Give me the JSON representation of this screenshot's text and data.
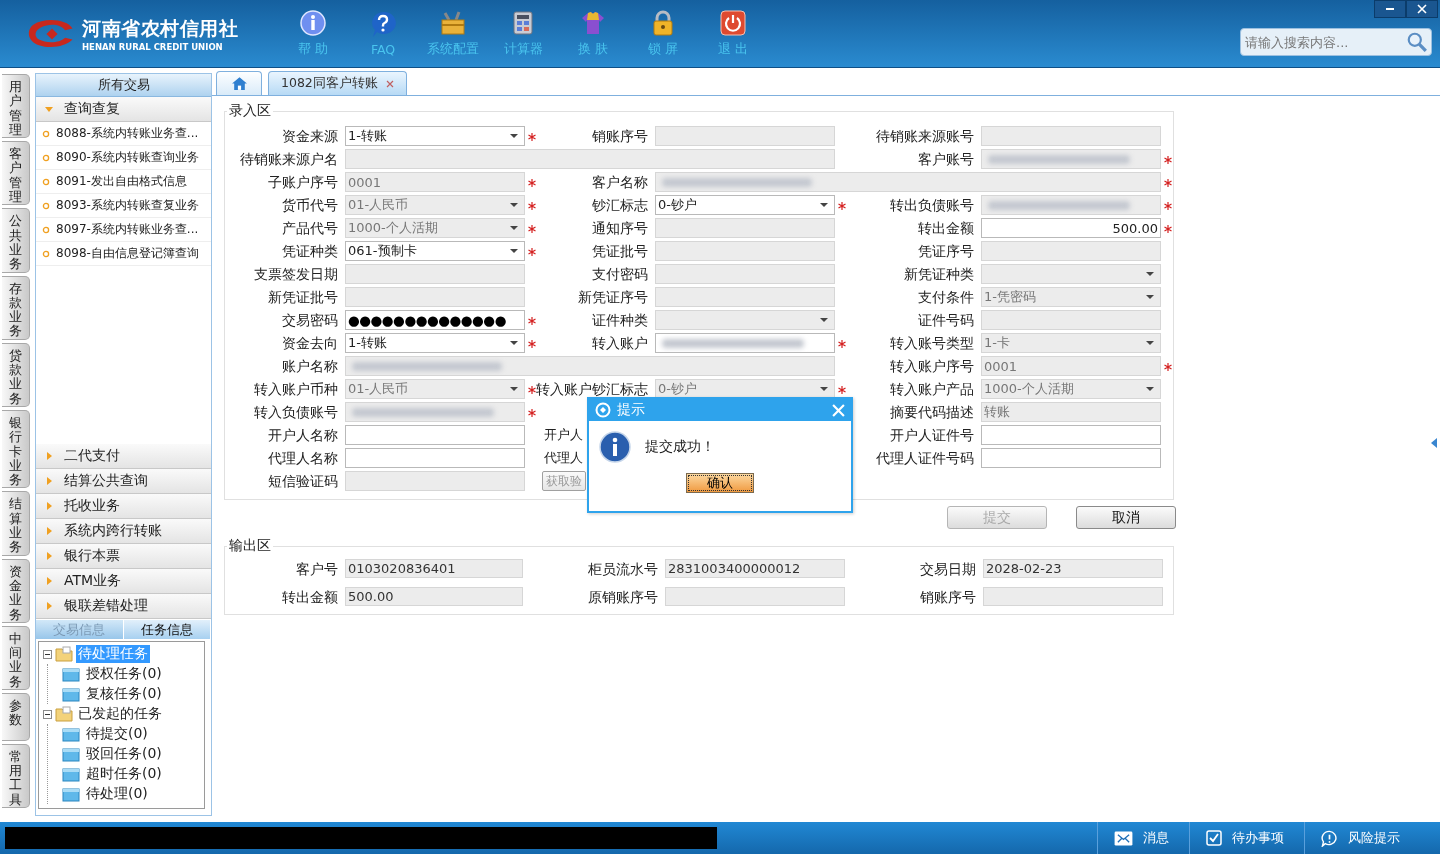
{
  "app": {
    "logo_title": "河南省农村信用社",
    "logo_subtitle": "HENAN RURAL CREDIT UNION"
  },
  "toolbar": [
    {
      "label": "帮 助",
      "kind": "help"
    },
    {
      "label": "FAQ",
      "kind": "faq"
    },
    {
      "label": "系统配置",
      "kind": "config"
    },
    {
      "label": "计算器",
      "kind": "calculator"
    },
    {
      "label": "换 肤",
      "kind": "skin"
    },
    {
      "label": "锁 屏",
      "kind": "lock"
    },
    {
      "label": "退 出",
      "kind": "exit"
    }
  ],
  "search": {
    "placeholder": "请输入搜索内容..."
  },
  "side_tabs": [
    "用户管理",
    "客户管理",
    "公共业务",
    "存款业务",
    "贷款业务",
    "银行卡业务",
    "结算业务",
    "资金业务",
    "中间业务",
    "参数",
    "常用工具"
  ],
  "sidebar": {
    "title": "所有交易",
    "groups": [
      {
        "label": "查询查复",
        "expanded": true,
        "items": [
          "8088-系统内转账业务查...",
          "8090-系统内转账查询业务",
          "8091-发出自由格式信息",
          "8093-系统内转账查复业务",
          "8097-系统内转账业务查...",
          "8098-自由信息登记簿查询"
        ]
      },
      {
        "label": "二代支付",
        "expanded": false
      },
      {
        "label": "结算公共查询",
        "expanded": false
      },
      {
        "label": "托收业务",
        "expanded": false
      },
      {
        "label": "系统内跨行转账",
        "expanded": false
      },
      {
        "label": "银行本票",
        "expanded": false
      },
      {
        "label": "ATM业务",
        "expanded": false
      },
      {
        "label": "银联差错处理",
        "expanded": false
      }
    ]
  },
  "task_panel": {
    "tabs": [
      {
        "label": "交易信息",
        "selected": false
      },
      {
        "label": "任务信息",
        "selected": true
      }
    ],
    "tree": [
      {
        "label": "待处理任务",
        "expanded": true,
        "selected": true,
        "children": [
          {
            "label": "授权任务(0)",
            "selected": false
          },
          {
            "label": "复核任务(0)",
            "selected": false
          }
        ]
      },
      {
        "label": "已发起的任务",
        "expanded": true,
        "selected": false,
        "children": [
          {
            "label": "待提交(0)",
            "selected": false
          },
          {
            "label": "驳回任务(0)",
            "selected": false
          },
          {
            "label": "超时任务(0)",
            "selected": false
          },
          {
            "label": "待处理(0)",
            "selected": false
          }
        ]
      }
    ]
  },
  "tabs": [
    {
      "kind": "home",
      "selected": false
    },
    {
      "kind": "page",
      "label": "1082同客户转账",
      "selected": true
    }
  ],
  "entry": {
    "title": "录入区",
    "rows": [
      {
        "col_1": {
          "label": "资金来源",
          "kind": "select",
          "value": "1-转账",
          "disabled": false,
          "required": true
        },
        "col_2": {
          "label": "销账序号",
          "kind": "input",
          "disabled": true,
          "required": false
        },
        "col_3": {
          "label": "待销账来源账号",
          "kind": "input",
          "disabled": true,
          "required": false
        }
      },
      {
        "col_1": {
          "label": "待销账来源户名",
          "kind": "wide",
          "disabled": true,
          "required": false
        },
        "col_3": {
          "label": "客户账号",
          "kind": "input",
          "disabled": true,
          "required": true,
          "redacted": true
        }
      },
      {
        "col_1": {
          "label": "子账户序号",
          "kind": "input",
          "value": "0001",
          "disabled": true,
          "required": true
        },
        "col_2": {
          "label": "客户名称",
          "kind": "wide",
          "disabled": true,
          "required": true,
          "redacted": true
        }
      },
      {
        "col_1": {
          "label": "货币代号",
          "kind": "select",
          "value": "01-人民币",
          "disabled": true,
          "required": true
        },
        "col_2": {
          "label": "钞汇标志",
          "kind": "select",
          "value": "0-钞户",
          "disabled": false,
          "required": true
        },
        "col_3": {
          "label": "转出负债账号",
          "kind": "input",
          "disabled": true,
          "required": true,
          "redacted": true
        }
      },
      {
        "col_1": {
          "label": "产品代号",
          "kind": "select",
          "value": "1000-个人活期",
          "disabled": true,
          "required": true
        },
        "col_2": {
          "label": "通知序号",
          "kind": "input",
          "disabled": true,
          "required": false
        },
        "col_3": {
          "label": "转出金额",
          "kind": "amount",
          "value": "500.00",
          "disabled": false,
          "required": true
        }
      },
      {
        "col_1": {
          "label": "凭证种类",
          "kind": "select",
          "value": "061-预制卡",
          "disabled": false,
          "required": true
        },
        "col_2": {
          "label": "凭证批号",
          "kind": "input",
          "disabled": true,
          "required": false
        },
        "col_3": {
          "label": "凭证序号",
          "kind": "input",
          "disabled": true,
          "required": false
        }
      },
      {
        "col_1": {
          "label": "支票签发日期",
          "kind": "input",
          "disabled": true,
          "required": false
        },
        "col_2": {
          "label": "支付密码",
          "kind": "input",
          "disabled": true,
          "required": false
        },
        "col_3": {
          "label": "新凭证种类",
          "kind": "select",
          "disabled": true,
          "required": false
        }
      },
      {
        "col_1": {
          "label": "新凭证批号",
          "kind": "input",
          "disabled": true,
          "required": false
        },
        "col_2": {
          "label": "新凭证序号",
          "kind": "input",
          "disabled": true,
          "required": false
        },
        "col_3": {
          "label": "支付条件",
          "kind": "select",
          "value": "1-凭密码",
          "disabled": true,
          "required": false
        }
      },
      {
        "col_1": {
          "label": "交易密码",
          "kind": "password",
          "value": "●●●●●●●●●●●●●●",
          "disabled": false,
          "required": true
        },
        "col_2": {
          "label": "证件种类",
          "kind": "select",
          "disabled": true,
          "required": false
        },
        "col_3": {
          "label": "证件号码",
          "kind": "input",
          "disabled": true,
          "required": false
        }
      },
      {
        "col_1": {
          "label": "资金去向",
          "kind": "select",
          "value": "1-转账",
          "disabled": false,
          "required": true
        },
        "col_2": {
          "label": "转入账户",
          "kind": "input",
          "disabled": false,
          "required": true,
          "redacted": true
        },
        "col_3": {
          "label": "转入账号类型",
          "kind": "select",
          "value": "1-卡",
          "disabled": true,
          "required": false
        }
      },
      {
        "col_1": {
          "label": "账户名称",
          "kind": "wide",
          "disabled": true,
          "required": false,
          "redacted": true
        },
        "col_3": {
          "label": "转入账户序号",
          "kind": "input",
          "value": "0001",
          "disabled": true,
          "required": true
        }
      },
      {
        "col_1": {
          "label": "转入账户币种",
          "kind": "select",
          "value": "01-人民币",
          "disabled": true,
          "required": true
        },
        "col_2": {
          "label": "转入账户钞汇标志",
          "kind": "select",
          "value": "0-钞户",
          "disabled": true,
          "required": true
        },
        "col_3": {
          "label": "转入账户产品",
          "kind": "select",
          "value": "1000-个人活期",
          "disabled": true,
          "required": false
        }
      },
      {
        "col_1": {
          "label": "转入负债账号",
          "kind": "input",
          "disabled": true,
          "required": true,
          "redacted": true
        },
        "col_3": {
          "label": "摘要代码描述",
          "kind": "input",
          "value": "转账",
          "disabled": true,
          "required": false
        }
      },
      {
        "col_1": {
          "label": "开户人名称",
          "kind": "input",
          "disabled": false,
          "required": false
        },
        "col_2": {
          "label": "开户人",
          "kind": "cut"
        },
        "col_3": {
          "label": "开户人证件号",
          "kind": "input",
          "disabled": false,
          "required": false
        }
      },
      {
        "col_1": {
          "label": "代理人名称",
          "kind": "input",
          "disabled": false,
          "required": false
        },
        "col_2": {
          "label": "代理人",
          "kind": "cut"
        },
        "col_3": {
          "label": "代理人证件号码",
          "kind": "input",
          "disabled": false,
          "required": false
        }
      },
      {
        "col_1": {
          "label": "短信验证码",
          "kind": "input",
          "disabled": true,
          "required": false
        },
        "col_2": {
          "label": "获取验",
          "kind": "button",
          "disabled": true
        }
      }
    ]
  },
  "buttons": [
    {
      "label": "提交",
      "disabled": true
    },
    {
      "label": "取消",
      "disabled": false
    }
  ],
  "output": {
    "title": "输出区",
    "rows": [
      [
        {
          "label": "客户号",
          "value": "0103020836401"
        },
        {
          "label": "柜员流水号",
          "value": "2831003400000012"
        },
        {
          "label": "交易日期",
          "value": "2028-02-23"
        }
      ],
      [
        {
          "label": "转出金额",
          "value": "500.00"
        },
        {
          "label": "原销账序号"
        },
        {
          "label": "销账序号"
        }
      ]
    ]
  },
  "dialog": {
    "title": "提示",
    "message": "提交成功！",
    "button": "确认"
  },
  "status_bar": {
    "items": [
      {
        "label": "消息",
        "kind": "message"
      },
      {
        "label": "待办事项",
        "kind": "todo"
      },
      {
        "label": "风险提示",
        "kind": "risk"
      }
    ]
  }
}
